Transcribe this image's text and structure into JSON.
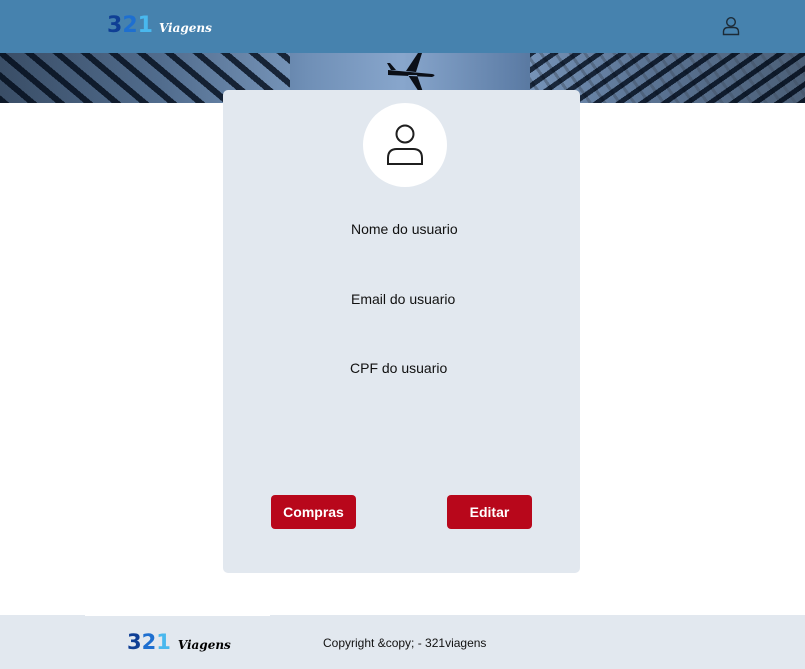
{
  "header": {
    "logo": {
      "digit_1": "3",
      "digit_2": "2",
      "digit_3": "1",
      "word": "Viagens"
    },
    "user_icon": "user-icon"
  },
  "banner": {
    "plane_icon": "airplane-icon"
  },
  "profile": {
    "avatar_icon": "user-icon",
    "name": "Nome do usuario",
    "email": "Email do usuario",
    "cpf": "CPF do usuario",
    "buttons": {
      "compras": "Compras",
      "editar": "Editar"
    }
  },
  "footer": {
    "logo": {
      "digit_1": "3",
      "digit_2": "2",
      "digit_3": "1",
      "word": "Viagens"
    },
    "copyright": "Copyright &copy; - 321viagens"
  },
  "colors": {
    "header_bg": "#4682ae",
    "card_bg": "#e2e8ef",
    "button_bg": "#b8071b",
    "logo_dark": "#0f3f95",
    "logo_mid": "#1e6fd0",
    "logo_light": "#49b8ee"
  }
}
